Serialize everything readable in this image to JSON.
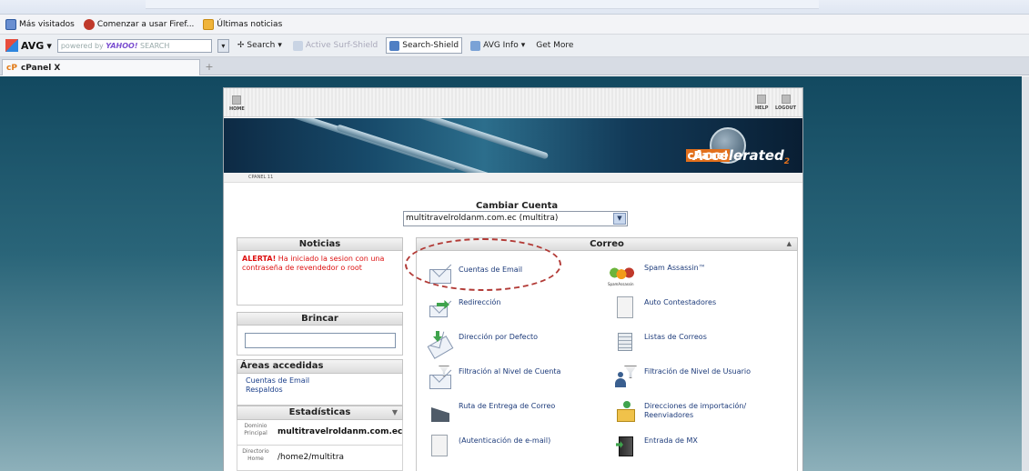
{
  "browser": {
    "bookmarks": [
      {
        "label": "Más visitados",
        "icon": "most-visited-icon"
      },
      {
        "label": "Comenzar a usar Firef...",
        "icon": "firefox-icon"
      },
      {
        "label": "Últimas noticias",
        "icon": "rss-icon"
      }
    ],
    "avg_toolbar": {
      "brand": "AVG",
      "brand_arrow": "▾",
      "search_placeholder_prefix": "powered by",
      "search_placeholder_brand": "YAHOO!",
      "search_placeholder_suffix": "SEARCH",
      "search_label": "Search",
      "active_surf_shield": "Active Surf-Shield",
      "search_shield": "Search-Shield",
      "avg_info": "AVG Info",
      "get_more": "Get More"
    },
    "tab": {
      "label": "cPanel X",
      "favicon_text": "cP"
    },
    "new_tab": "+"
  },
  "cpanel": {
    "header": {
      "home": "HOME",
      "help": "HELP",
      "logout": "LOGOUT"
    },
    "banner": {
      "logo_word": "cPanel",
      "accelerated": "Accelerated",
      "sub": "2"
    },
    "subbar": "CPANEL 11",
    "account": {
      "title": "Cambiar Cuenta",
      "selected": "multitravelroldanm.com.ec (multitra)"
    },
    "news": {
      "title": "Noticias",
      "alert_bold": "ALERTA!",
      "alert_text": " Ha iniciado la sesion con una contraseña de revendedor o root"
    },
    "jump": {
      "title": "Brincar",
      "value": ""
    },
    "frequent": {
      "title": "Áreas accedidas frecuentemente",
      "links": [
        "Cuentas de Email",
        "Respaldos"
      ]
    },
    "stats": {
      "title": "Estadísticas",
      "toggle": "▼",
      "rows": [
        {
          "key": "Dominio Principal",
          "value": "multitravelroldanm.com.ec"
        },
        {
          "key": "Directorio Home",
          "value": "/home2/multitra"
        }
      ]
    },
    "mail": {
      "title": "Correo",
      "collapse": "▲",
      "items": [
        {
          "label": "Cuentas de Email",
          "icon": "email-accounts-icon"
        },
        {
          "label": "Spam Assassin™",
          "icon": "spam-assassin-icon",
          "icon_caption": "SpamAssassin"
        },
        {
          "label": "Redirección",
          "icon": "forwarders-icon"
        },
        {
          "label": "Auto Contestadores",
          "icon": "autoresponders-icon"
        },
        {
          "label": "Dirección por Defecto",
          "icon": "default-address-icon"
        },
        {
          "label": "Listas de Correos",
          "icon": "mailing-lists-icon"
        },
        {
          "label": "Filtración al Nivel de Cuenta",
          "icon": "account-filter-icon"
        },
        {
          "label": "Filtración de Nivel de Usuario",
          "icon": "user-filter-icon"
        },
        {
          "label": "Ruta de Entrega de Correo",
          "icon": "delivery-route-icon"
        },
        {
          "label": "Direcciones de importación/ Reenviadores",
          "icon": "import-addresses-icon"
        },
        {
          "label": "(Autenticación de e-mail)",
          "icon": "email-auth-icon"
        },
        {
          "label": "Entrada de MX",
          "icon": "mx-entry-icon"
        }
      ]
    }
  }
}
